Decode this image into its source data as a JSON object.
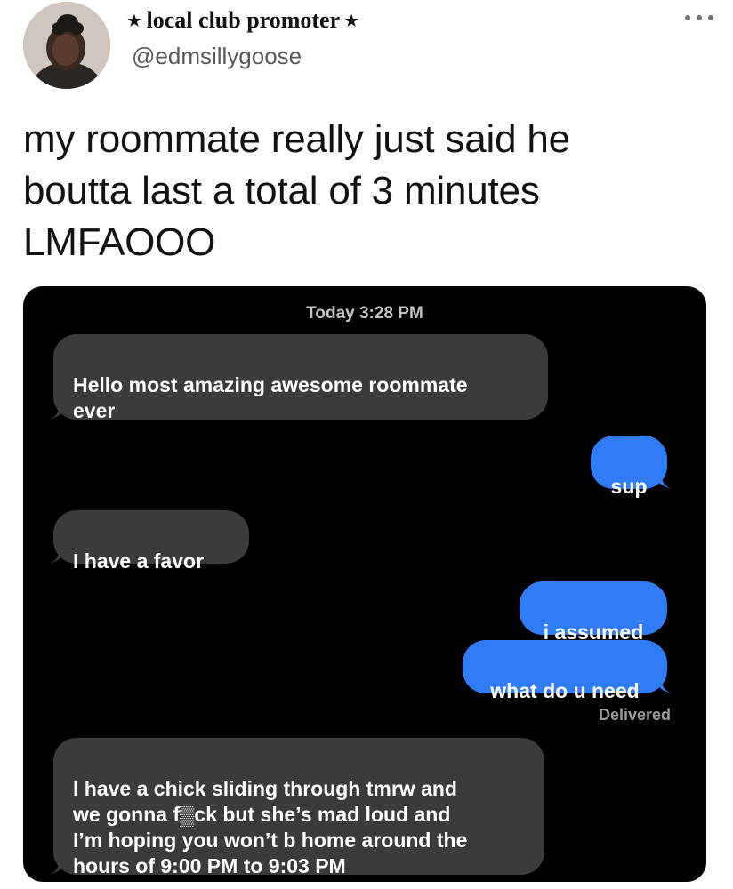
{
  "tweet": {
    "display_name": "⭒ local club promoter ⭒",
    "handle": "@edmsillygoose",
    "text": "my roommate really just said he\nboutta last a total of 3 minutes\nLMFAOOO",
    "more_icon": "more-horizontal-icon",
    "avatar_icon": "profile-avatar"
  },
  "imessage": {
    "timestamp": "Today 3:28 PM",
    "delivered": "Delivered",
    "colors": {
      "sent_bubble": "#2f7cf6",
      "received_bubble": "#3b3b3d",
      "background": "#000000"
    },
    "messages": [
      {
        "side": "received",
        "text": "Hello most amazing awesome roommate\never"
      },
      {
        "side": "sent",
        "text": "sup"
      },
      {
        "side": "received",
        "text": "I have a favor"
      },
      {
        "side": "sent",
        "text": "i assumed"
      },
      {
        "side": "sent",
        "text": "what do u need"
      },
      {
        "side": "received",
        "text": "I have a chick sliding through tmrw and\nwe gonna f▒ck but she’s mad loud and\nI’m hoping you won’t b home around the\nhours of 9:00 PM to 9:03 PM"
      }
    ]
  }
}
